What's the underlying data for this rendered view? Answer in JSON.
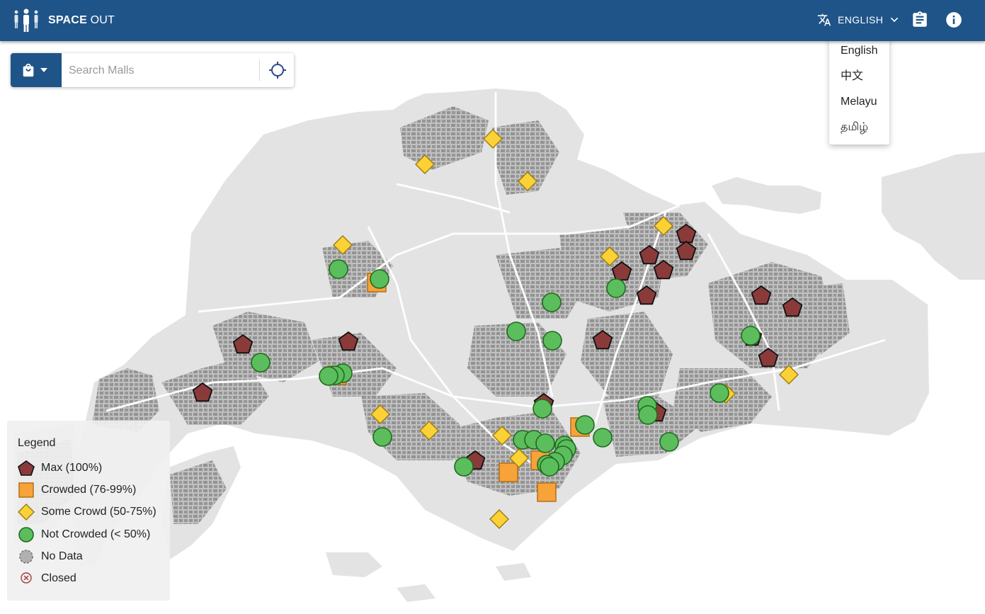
{
  "app": {
    "brand_bold": "SPACE",
    "brand_light": " OUT"
  },
  "header": {
    "language_label": "ENGLISH",
    "icons": [
      "translate-icon",
      "chevron-down-icon",
      "clipboard-icon",
      "info-icon"
    ]
  },
  "language_menu": {
    "options": [
      "English",
      "中文",
      "Melayu",
      "தமிழ்"
    ]
  },
  "search": {
    "placeholder": "Search Malls",
    "icons": [
      "shopping-bag-icon",
      "caret-down-icon",
      "crosshair-icon"
    ]
  },
  "legend": {
    "title": "Legend",
    "items": [
      {
        "label": "Max (100%)",
        "shape": "pentagon",
        "color": "#8b3a3a"
      },
      {
        "label": "Crowded (76-99%)",
        "shape": "square",
        "color": "#f7a33a"
      },
      {
        "label": "Some Crowd (50-75%)",
        "shape": "diamond",
        "color": "#fcd136"
      },
      {
        "label": "Not Crowded (< 50%)",
        "shape": "circle",
        "color": "#5cbd5c"
      },
      {
        "label": "No Data",
        "shape": "dashed-circle",
        "color": "#b0b0b0"
      },
      {
        "label": "Closed",
        "shape": "x-circle",
        "color": "#a13a3a"
      }
    ]
  },
  "colors": {
    "header": "#1f5488",
    "max": "#8b3a3a",
    "crowded": "#f7a33a",
    "some": "#fcd136",
    "not_crowded": "#5cbd5c",
    "land": "#e4e4e4",
    "buildings": "#8c8c8c"
  }
}
